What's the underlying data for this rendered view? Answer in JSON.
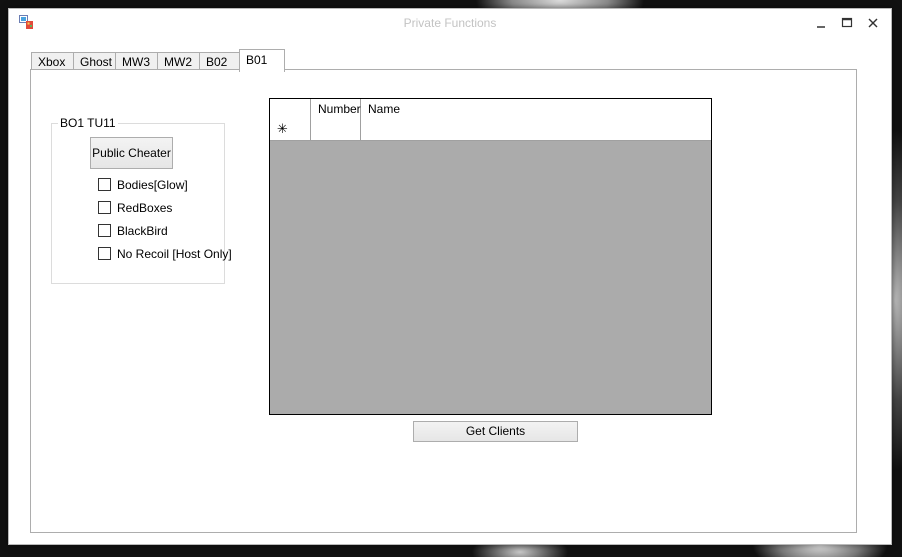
{
  "window": {
    "title": "Private Functions",
    "controls": {
      "minimize": "minimize-icon",
      "maximize": "maximize-icon",
      "close": "close-icon"
    }
  },
  "tabs": [
    {
      "label": "Xbox",
      "active": false
    },
    {
      "label": "Ghost",
      "active": false
    },
    {
      "label": "MW3",
      "active": false
    },
    {
      "label": "MW2",
      "active": false
    },
    {
      "label": "B02",
      "active": false
    },
    {
      "label": "B01",
      "active": true
    }
  ],
  "group": {
    "title": "BO1 TU11",
    "button_label": "Public Cheater",
    "checkboxes": [
      {
        "label": "Bodies[Glow]",
        "checked": false
      },
      {
        "label": "RedBoxes",
        "checked": false
      },
      {
        "label": "BlackBird",
        "checked": false
      },
      {
        "label": "No Recoil [Host Only]",
        "checked": false
      }
    ]
  },
  "grid": {
    "columns": [
      "Number",
      "Name"
    ],
    "new_row_glyph": "✳"
  },
  "actions": {
    "get_clients_label": "Get Clients"
  },
  "colors": {
    "title_text": "#c3c3c3",
    "grid_background": "#ababab"
  }
}
